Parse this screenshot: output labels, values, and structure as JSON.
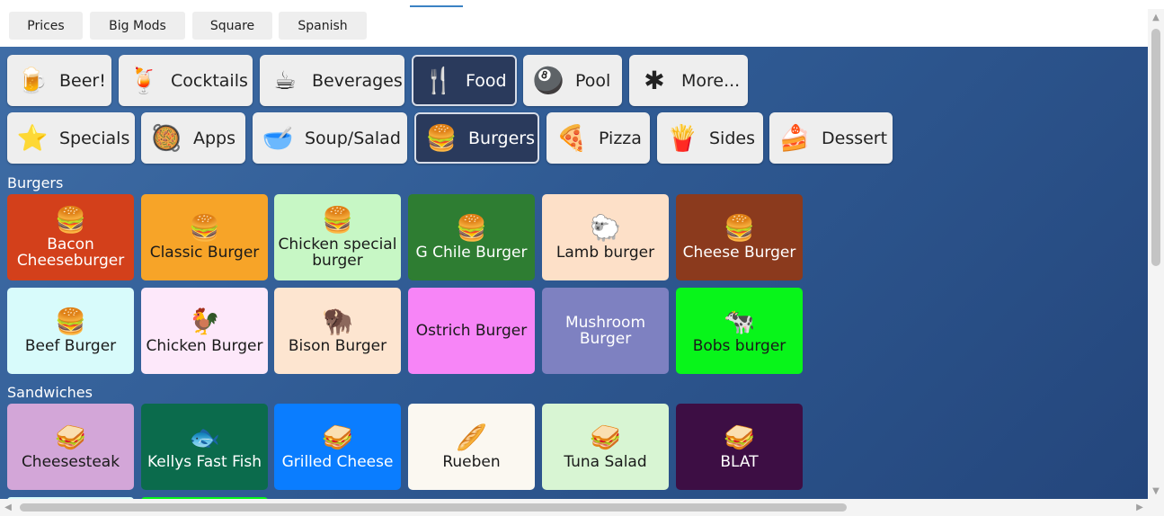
{
  "top_tabs": [
    "Prices",
    "Big Mods",
    "Square",
    "Spanish"
  ],
  "categories_row1": [
    {
      "label": "Beer!",
      "icon": "beer-mug-icon",
      "glyph": "🍺",
      "active": false
    },
    {
      "label": "Cocktails",
      "icon": "cocktail-icon",
      "glyph": "🍹",
      "active": false
    },
    {
      "label": "Beverages",
      "icon": "mug-icon",
      "glyph": "☕",
      "active": false
    },
    {
      "label": "Food",
      "icon": "menu-icon",
      "glyph": "🍴",
      "active": true
    },
    {
      "label": "Pool",
      "icon": "eight-ball-icon",
      "glyph": "🎱",
      "active": false
    },
    {
      "label": "More...",
      "icon": "asterisk-icon",
      "glyph": "✱",
      "active": false
    }
  ],
  "categories_row2": [
    {
      "label": "Specials",
      "icon": "star-icon",
      "glyph": "⭐",
      "active": false
    },
    {
      "label": "Apps",
      "icon": "appetizer-icon",
      "glyph": "🥘",
      "active": false
    },
    {
      "label": "Soup/Salad",
      "icon": "soup-bowl-icon",
      "glyph": "🥣",
      "active": false
    },
    {
      "label": "Burgers",
      "icon": "burger-icon",
      "glyph": "🍔",
      "active": true
    },
    {
      "label": "Pizza",
      "icon": "pizza-icon",
      "glyph": "🍕",
      "active": false
    },
    {
      "label": "Sides",
      "icon": "fries-icon",
      "glyph": "🍟",
      "active": false
    },
    {
      "label": "Dessert",
      "icon": "cake-icon",
      "glyph": "🍰",
      "active": false
    }
  ],
  "sections": [
    {
      "title": "Burgers",
      "items": [
        {
          "label": "Bacon Cheeseburger",
          "icon": "burger-icon",
          "glyph": "🍔",
          "bg": "#d3401b",
          "fg": "#ffffff"
        },
        {
          "label": "Classic Burger",
          "icon": "burger-icon",
          "glyph": "🍔",
          "bg": "#f7a428",
          "fg": "#1a1a1a"
        },
        {
          "label": "Chicken special burger",
          "icon": "burger-icon",
          "glyph": "🍔",
          "bg": "#c7f7c5",
          "fg": "#1a1a1a"
        },
        {
          "label": "G Chile Burger",
          "icon": "burger-icon",
          "glyph": "🍔",
          "bg": "#2e7d32",
          "fg": "#ffffff"
        },
        {
          "label": "Lamb burger",
          "icon": "sheep-icon",
          "glyph": "🐑",
          "bg": "#fde0c8",
          "fg": "#1a1a1a"
        },
        {
          "label": "Cheese Burger",
          "icon": "burger-icon",
          "glyph": "🍔",
          "bg": "#8b3a1d",
          "fg": "#ffffff"
        },
        {
          "label": "Beef Burger",
          "icon": "burger-icon",
          "glyph": "🍔",
          "bg": "#d8fbfb",
          "fg": "#1a1a1a"
        },
        {
          "label": "Chicken Burger",
          "icon": "chicken-icon",
          "glyph": "🐓",
          "bg": "#fde8fa",
          "fg": "#1a1a1a"
        },
        {
          "label": "Bison Burger",
          "icon": "bison-icon",
          "glyph": "🦬",
          "bg": "#fde5d0",
          "fg": "#1a1a1a"
        },
        {
          "label": "Ostrich Burger",
          "icon": "",
          "glyph": "",
          "bg": "#f785f7",
          "fg": "#1a1a1a"
        },
        {
          "label": "Mushroom Burger",
          "icon": "",
          "glyph": "",
          "bg": "#7e81c1",
          "fg": "#ffffff"
        },
        {
          "label": "Bobs burger",
          "icon": "cow-icon",
          "glyph": "🐄",
          "bg": "#08f51a",
          "fg": "#1a1a1a"
        }
      ]
    },
    {
      "title": "Sandwiches",
      "items": [
        {
          "label": "Cheesesteak",
          "icon": "sandwich-icon",
          "glyph": "🥪",
          "bg": "#d3a6d8",
          "fg": "#1a1a1a"
        },
        {
          "label": "Kellys Fast Fish",
          "icon": "fish-icon",
          "glyph": "🐟",
          "bg": "#0b6b4c",
          "fg": "#ffffff"
        },
        {
          "label": "Grilled Cheese",
          "icon": "sandwich-icon",
          "glyph": "🥪",
          "bg": "#0a7dff",
          "fg": "#ffffff"
        },
        {
          "label": "Rueben",
          "icon": "sub-sandwich-icon",
          "glyph": "🥖",
          "bg": "#fbf8f1",
          "fg": "#1a1a1a"
        },
        {
          "label": "Tuna Salad",
          "icon": "sandwich-icon",
          "glyph": "🥪",
          "bg": "#d8f5d3",
          "fg": "#1a1a1a"
        },
        {
          "label": "BLAT",
          "icon": "sandwich-icon",
          "glyph": "🥪",
          "bg": "#3d0e44",
          "fg": "#ffffff"
        }
      ]
    }
  ],
  "stubs": [
    {
      "bg": "#d8fbfb"
    },
    {
      "bg": "#08f51a"
    }
  ],
  "scroll": {
    "up": "▲",
    "down": "▼",
    "left": "◀",
    "right": "▶"
  }
}
